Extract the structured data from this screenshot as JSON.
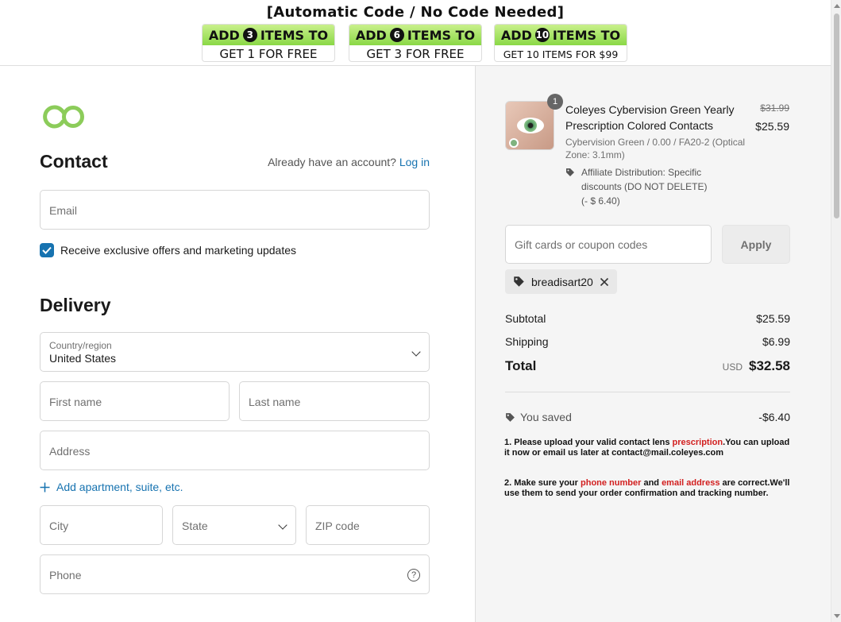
{
  "promo": {
    "title": "[Automatic Code / No Code Needed]",
    "tiles": [
      {
        "top_prefix": "ADD",
        "num": "3",
        "top_suffix": "ITEMS TO",
        "bottom": "GET 1 FOR FREE"
      },
      {
        "top_prefix": "ADD",
        "num": "6",
        "top_suffix": "ITEMS TO",
        "bottom": "GET 3 FOR FREE"
      },
      {
        "top_prefix": "ADD",
        "num": "10",
        "top_suffix": "ITEMS TO",
        "bottom": "GET 10 ITEMS FOR $99"
      }
    ]
  },
  "contact": {
    "heading": "Contact",
    "account_prompt": "Already have an account?",
    "login_link": "Log in",
    "email_placeholder": "Email",
    "marketing_label": "Receive exclusive offers and marketing updates",
    "marketing_checked": true
  },
  "delivery": {
    "heading": "Delivery",
    "country_label": "Country/region",
    "country_value": "United States",
    "first_name_placeholder": "First name",
    "last_name_placeholder": "Last name",
    "address_placeholder": "Address",
    "add_apartment": "Add apartment, suite, etc.",
    "city_placeholder": "City",
    "state_placeholder": "State",
    "zip_placeholder": "ZIP code",
    "phone_placeholder": "Phone"
  },
  "summary": {
    "product": {
      "quantity": "1",
      "name": "Coleyes Cybervision Green Yearly Prescription Colored Contacts",
      "variant": "Cybervision Green / 0.00 / FA20-2 (Optical Zone: 3.1mm)",
      "discount_label": "Affiliate Distribution: Specific discounts (DO NOT DELETE)",
      "discount_amount": "(- $ 6.40)",
      "price_original": "$31.99",
      "price_current": "$25.59"
    },
    "coupon_placeholder": "Gift cards or coupon codes",
    "apply_label": "Apply",
    "applied_code": "breadisart20",
    "subtotal_label": "Subtotal",
    "subtotal_value": "$25.59",
    "shipping_label": "Shipping",
    "shipping_value": "$6.99",
    "total_label": "Total",
    "total_currency": "USD",
    "total_value": "$32.58",
    "saved_label": "You saved",
    "saved_value": "-$6.40",
    "note1_a": "1. Please upload your valid contact lens ",
    "note1_red": "prescription",
    "note1_b": ".You can upload it now or email us later at contact@mail.coleyes.com",
    "note2_a": "2. Make sure your ",
    "note2_red1": "phone number",
    "note2_mid": " and ",
    "note2_red2": "email address",
    "note2_b": " are correct.We'll use them to send your order confirmation and tracking number."
  },
  "colors": {
    "accent": "#1773b0",
    "logo": "#8ccc5a",
    "promo_green": "#8ad846",
    "note_red": "#d21f1f"
  }
}
